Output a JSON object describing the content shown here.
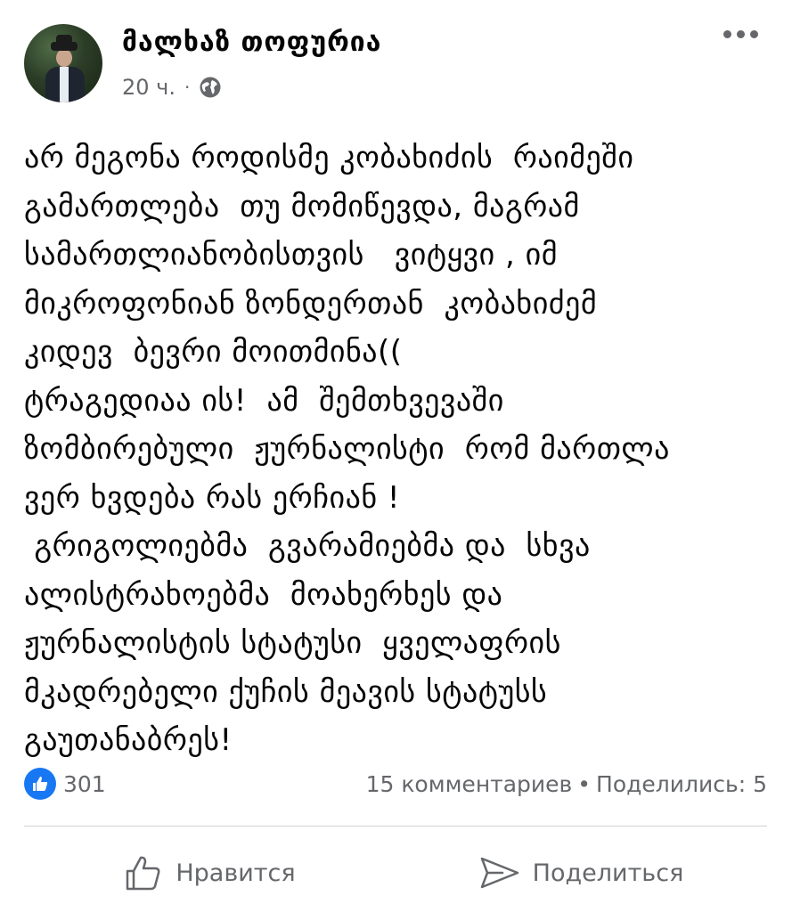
{
  "post": {
    "author": "მალხაზ თოფურია",
    "time": "20 ч.",
    "separator": "·",
    "privacy_icon": "globe-icon",
    "text_lines": [
      "არ მეგონა როდისმე კობახიძის  რაიმეში",
      "გამართლება  თუ მომიწევდა, მაგრამ",
      "სამართლიანობისთვის   ვიტყვი , იმ",
      "მიკროფონიან ზონდერთან  კობახიძემ",
      "კიდევ  ბევრი მოითმინა((",
      "ტრაგედიაა ის!  ამ  შემთხვევაში",
      "ზომბირებული  ჟურნალისტი  რომ მართლა",
      "ვერ ხვდება რას ერჩიან !",
      " გრიგოლიებმა  გვარამიებმა და  სხვა",
      "ალისტრახოებმა  მოახერხეს და",
      "ჟურნალისტის სტატუსი  ყველაფრის",
      "მკადრებელი ქუჩის მეავის სტატუსს",
      "გაუთანაბრეს!"
    ]
  },
  "stats": {
    "likes": "301",
    "comments": "15 комментариев",
    "dot": "•",
    "shares": "Поделились: 5"
  },
  "actions": {
    "like_label": "Нравится",
    "share_label": "Поделиться"
  },
  "colors": {
    "accent": "#1877f2",
    "muted": "#65676b",
    "text": "#050505",
    "divider": "#ced0d4"
  }
}
